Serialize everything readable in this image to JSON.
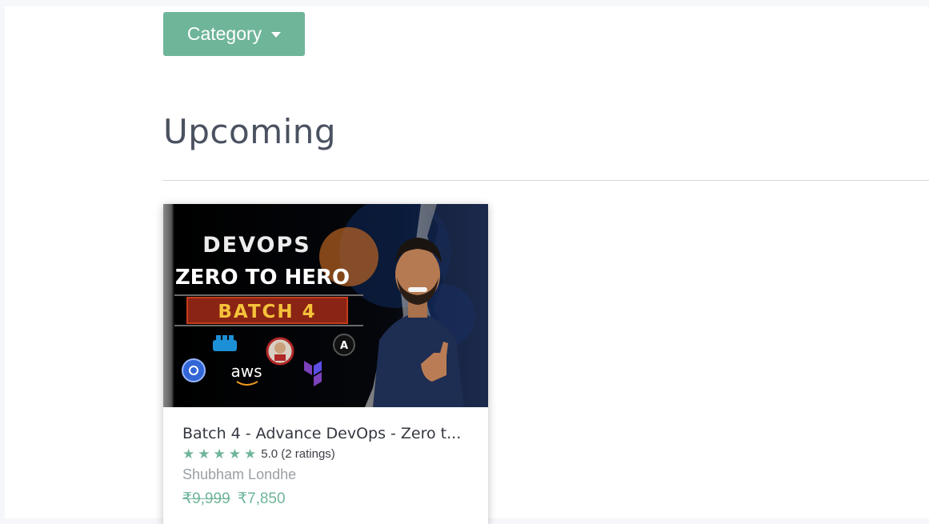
{
  "category_button": {
    "label": "Category",
    "icon": "caret-down-icon"
  },
  "section": {
    "title": "Upcoming"
  },
  "courses": [
    {
      "thumbnail": {
        "line1": "DEVOPS",
        "line2": "ZERO TO HERO",
        "line3": "BATCH 4",
        "logo_aws": "aws",
        "logo_ansible": "A"
      },
      "title": "Batch 4 - Advance DevOps - Zero t...",
      "rating": {
        "stars": 5,
        "text": "5.0 (2 ratings)"
      },
      "author": "Shubham Londhe",
      "original_price": "₹9,999",
      "price": "₹7,850"
    }
  ],
  "colors": {
    "accent": "#6fb59a",
    "title_text": "#4a5160",
    "background": "#f5f7fa"
  }
}
